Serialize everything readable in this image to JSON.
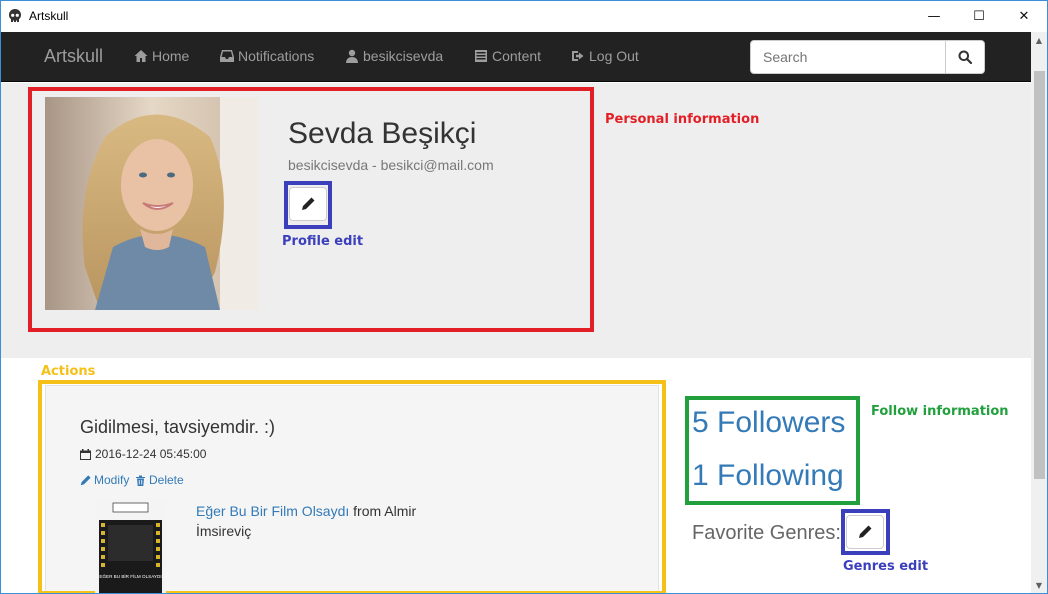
{
  "window": {
    "title": "Artskull",
    "minimize_glyph": "—",
    "maximize_glyph": "☐",
    "close_glyph": "✕"
  },
  "navbar": {
    "brand": "Artskull",
    "items": [
      {
        "label": "Home",
        "icon": "home-icon"
      },
      {
        "label": "Notifications",
        "icon": "inbox-icon"
      },
      {
        "label": "besikcisevda",
        "icon": "user-icon"
      },
      {
        "label": "Content",
        "icon": "list-icon"
      },
      {
        "label": "Log Out",
        "icon": "logout-icon"
      }
    ],
    "search_placeholder": "Search"
  },
  "profile": {
    "name": "Sevda Beşikçi",
    "subtitle": "besikcisevda - besikci@mail.com"
  },
  "annotations": {
    "personal_information": "Personal information",
    "profile_edit": "Profile edit",
    "actions": "Actions",
    "follow_information": "Follow information",
    "genres_edit": "Genres edit"
  },
  "action": {
    "title": "Gidilmesi, tavsiyemdir. :)",
    "date": "2016-12-24 05:45:00",
    "modify_label": "Modify",
    "delete_label": "Delete",
    "film_title": "Eğer Bu Bir Film Olsaydı",
    "film_from": " from Almir İmsireviç",
    "poster_text": "EĞER BU BİR FİLM OLSAYDI"
  },
  "follow": {
    "followers": "5 Followers",
    "following": "1 Following",
    "favorite_genres_label": "Favorite Genres:"
  },
  "colors": {
    "navbar_bg": "#222222",
    "link": "#337ab7",
    "annotation_red": "#e21f26",
    "annotation_blue": "#3c3fbb",
    "annotation_yellow": "#f5c118",
    "annotation_green": "#22a03d"
  }
}
